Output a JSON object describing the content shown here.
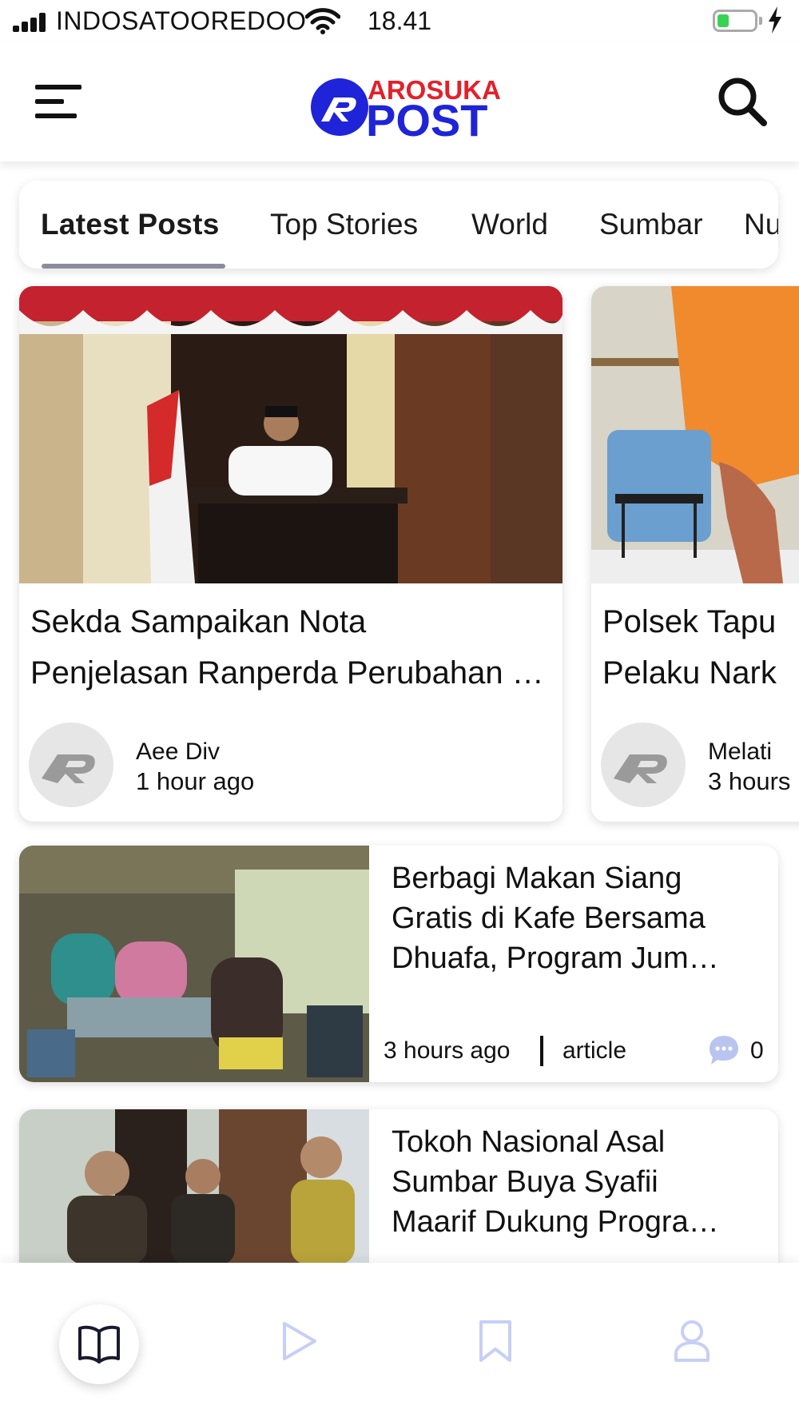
{
  "status_bar": {
    "carrier": "INDOSATOOREDOO",
    "time": "18.41",
    "battery_color": "#39d353"
  },
  "header": {
    "logo_top": "AROSUKA",
    "logo_bottom": "POST",
    "logo_red": "#e3202a",
    "logo_blue": "#1f24d8",
    "menu_icon": "hamburger-icon",
    "search_icon": "search-icon"
  },
  "tabs": [
    "Latest Posts",
    "Top Stories",
    "World",
    "Sumbar",
    "Nu"
  ],
  "featured": [
    {
      "title_line1": "Sekda Sampaikan Nota",
      "title_line2": "Penjelasan Ranperda Perubahan …",
      "author": "Aee Div",
      "time": "1 hour ago"
    },
    {
      "title_line1": "Polsek Tapu",
      "title_line2": "Pelaku Nark",
      "author": "Melati",
      "time": "3 hours"
    }
  ],
  "list": [
    {
      "title_lines": [
        "Berbagi Makan Siang",
        "Gratis di Kafe Bersama",
        "Dhuafa, Program Jum…"
      ],
      "time": "3 hours ago",
      "category": "article",
      "comments": "0"
    },
    {
      "title_lines": [
        "Tokoh Nasional Asal",
        "Sumbar Buya Syafii",
        "Maarif Dukung Progra…"
      ]
    }
  ],
  "bottom_nav": {
    "items": [
      "book-icon",
      "play-icon",
      "bookmark-icon",
      "user-icon"
    ],
    "active_color": "#1a1a2e",
    "inactive_color": "#c8cff5"
  }
}
